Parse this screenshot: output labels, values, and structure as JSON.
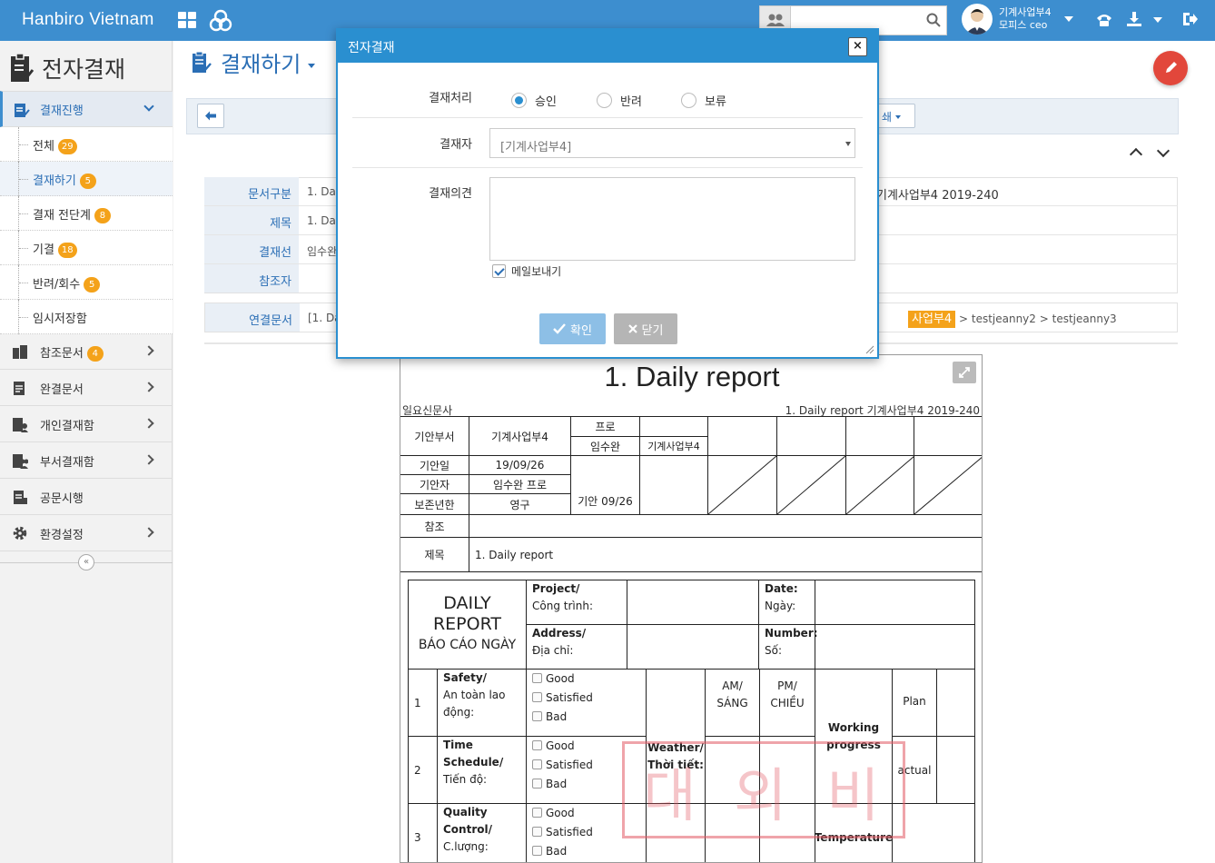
{
  "header": {
    "brand": "Hanbiro Vietnam",
    "search_placeholder": "",
    "user_line1": "기계사업부4",
    "user_line2": "모피스 ceo"
  },
  "sidebar": {
    "title": "전자결재",
    "section": "결재진행",
    "sub_items": [
      {
        "label": "전체",
        "badge": "29"
      },
      {
        "label": "결재하기",
        "badge": "5"
      },
      {
        "label": "결재 전단계",
        "badge": "8"
      },
      {
        "label": "기결",
        "badge": "18"
      },
      {
        "label": "반려/회수",
        "badge": "5"
      },
      {
        "label": "임시저장함",
        "badge": ""
      }
    ],
    "menus": [
      {
        "label": "참조문서",
        "badge": "4"
      },
      {
        "label": "완결문서",
        "badge": ""
      },
      {
        "label": "개인결재함",
        "badge": ""
      },
      {
        "label": "부서결재함",
        "badge": ""
      },
      {
        "label": "공문시행",
        "badge": ""
      },
      {
        "label": "환경설정",
        "badge": ""
      }
    ],
    "collapse_glyph": "«"
  },
  "content": {
    "page_title": "결재하기",
    "print_label": "쇄",
    "info": [
      {
        "key": "문서구분",
        "value": "1. Da",
        "right": "기계사업부4 2019-240"
      },
      {
        "key": "제목",
        "value": "1. Da",
        "right": ""
      },
      {
        "key": "결재선",
        "value": "임수완",
        "right": ""
      },
      {
        "key": "참조자",
        "value": "",
        "right": ""
      }
    ],
    "link": {
      "key": "연결문서",
      "value": "[1. Da",
      "flow_hl": "사업부4",
      "flow_1": "testjeanny2",
      "flow_2": "testjeanny3"
    }
  },
  "document": {
    "title": "1. Daily report",
    "sub_left": "일요신문사",
    "sub_right": "1. Daily report 기계사업부4 2019-240",
    "rows": {
      "dept_label": "기안부서",
      "dept_value": "기계사업부4",
      "rank": "프로",
      "approver_name": "임수완",
      "approver_dept": "기계사업부4",
      "date_label": "기안일",
      "date_value": "19/09/26",
      "drafter_label": "기안자",
      "drafter_value": "임수완 프로",
      "retention_label": "보존년한",
      "retention_value": "영구",
      "draft_stamp": "기안 09/26",
      "ref_label": "참조",
      "subject_label": "제목",
      "subject_value": "1. Daily report"
    },
    "report": {
      "title1": "DAILY",
      "title2": "REPORT",
      "title3": "BÁO CÁO NGÀY",
      "project_b": "Project/",
      "project": "Công trình:",
      "date_b": "Date:",
      "date": "Ngày:",
      "address_b": "Address/",
      "address": "Địa chỉ:",
      "number_b": "Number:",
      "number": "Số:",
      "items": [
        {
          "no": "1",
          "name_b": "Safety/",
          "name": "An toàn lao",
          "name2": "động:"
        },
        {
          "no": "2",
          "name_b": "Time",
          "name": "Schedule/",
          "name2": "Tiến độ:"
        },
        {
          "no": "3",
          "name_b": "Quality",
          "name": "Control/",
          "name2": "C.lượng:"
        }
      ],
      "good": "Good",
      "satisfied": "Satisfied",
      "bad": "Bad",
      "am": "AM/",
      "am2": "SÁNG",
      "pm": "PM/",
      "pm2": "CHIỀU",
      "weather_b": "Weather/",
      "weather2": "Thời tiết:",
      "working_b": "Working",
      "working2": "progress",
      "plan": "Plan",
      "actual": "actual",
      "temperature": "Temperature"
    },
    "stamp_chars": [
      "대",
      "외",
      "비"
    ]
  },
  "modal": {
    "title": "전자결재",
    "close": "×",
    "label_process": "결재처리",
    "opt_approve": "승인",
    "opt_reject": "반려",
    "opt_hold": "보류",
    "label_approver": "결재자",
    "approver_value": "[기계사업부4]",
    "label_opinion": "결재의견",
    "mail_label": "메일보내기",
    "ok_label": "확인",
    "close_label": "닫기"
  },
  "colors": {
    "topbar": "#3d8ecf",
    "modal_accent": "#2a8fd0",
    "badge": "#f4a21a",
    "fab": "#e2473b"
  }
}
